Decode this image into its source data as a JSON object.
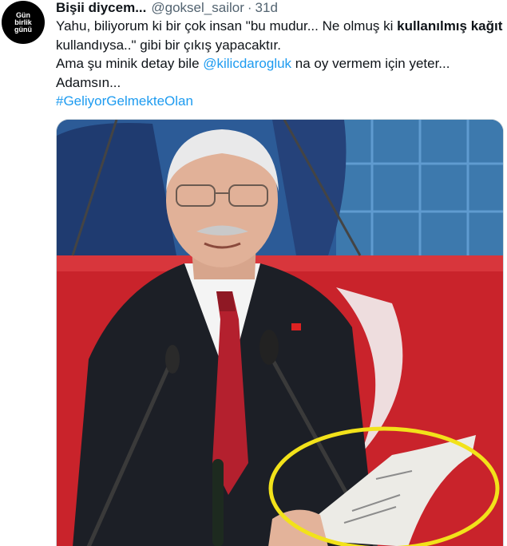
{
  "tweet": {
    "avatar_text": [
      "Gün",
      "birlik",
      "günü"
    ],
    "display_name": "Bişii diycem...",
    "handle": "@goksel_sailor",
    "separator": "·",
    "time": "31d",
    "line1_a": "Yahu, biliyorum ki bir çok insan \"bu mudur... Ne olmuş ki ",
    "line1_bold": "kullanılmış kağıt",
    "line2": "kullandıysa..\" gibi bir çıkış yapacaktır.",
    "line3_a": "Ama şu minik detay bile ",
    "mention": "@kilicdarogluk",
    "line3_b": " na oy vermem için yeter...",
    "line4": "Adamsın...",
    "hashtag": "#GeliyorGelmekteOlan"
  },
  "media": {
    "description_colors": {
      "backdrop_blue": "#3d79ad",
      "flag_red": "#d4242a",
      "suit": "#1c1f26",
      "tie": "#b4202e",
      "highlight_circle": "#f2e21a"
    }
  }
}
